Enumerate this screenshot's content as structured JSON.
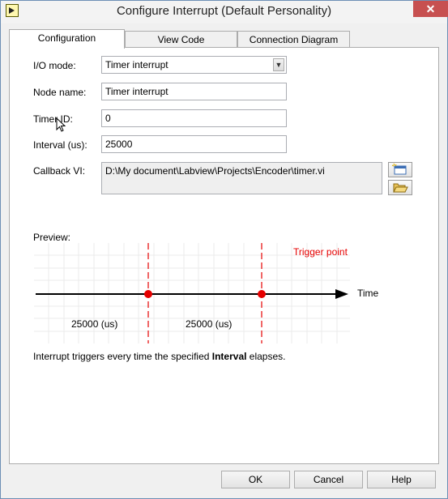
{
  "window": {
    "title": "Configure Interrupt (Default Personality)",
    "close_glyph": "✕"
  },
  "tabs": [
    {
      "label": "Configuration",
      "active": true
    },
    {
      "label": "View Code",
      "active": false
    },
    {
      "label": "Connection Diagram",
      "active": false
    }
  ],
  "form": {
    "io_mode": {
      "label": "I/O mode:",
      "value": "Timer interrupt"
    },
    "node_name": {
      "label": "Node name:",
      "value": "Timer interrupt"
    },
    "timer_id": {
      "label": "Timer ID:",
      "value": "0"
    },
    "interval": {
      "label": "Interval (us):",
      "value": "25000"
    },
    "callback": {
      "label": "Callback VI:",
      "value": "D:\\My document\\Labview\\Projects\\Encoder\\timer.vi"
    }
  },
  "preview": {
    "label": "Preview:",
    "trigger_label": "Trigger point",
    "axis_label": "Time",
    "interval_labels": [
      "25000 (us)",
      "25000 (us)"
    ],
    "colors": {
      "trigger": "#e60000",
      "grid": "#e8e8e8",
      "axis": "#000000"
    }
  },
  "description": {
    "before": "Interrupt triggers every time the specified ",
    "bold": "Interval",
    "after": " elapses."
  },
  "buttons": {
    "ok": "OK",
    "cancel": "Cancel",
    "help": "Help"
  },
  "icons": {
    "new_vi": "new-vi-icon",
    "browse": "folder-open-icon",
    "dropdown": "chevron-down-icon",
    "cursor": "mouse-pointer-icon"
  }
}
